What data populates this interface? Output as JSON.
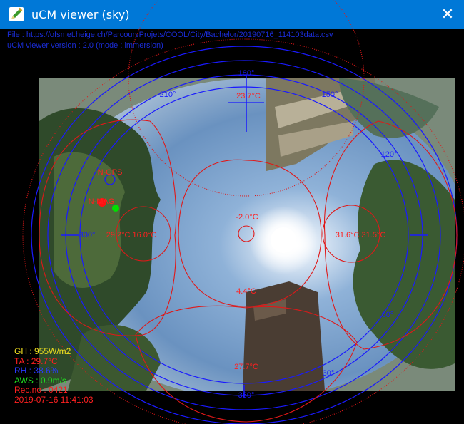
{
  "window": {
    "title": "uCM viewer (sky)",
    "close_glyph": "✕",
    "icon": "pencil-icon"
  },
  "header": {
    "file_line": "File : https://ofsmet.heige.ch/ParcoursProjets/COOL/City/Bachelor/20190716_114103data.csv",
    "version_line": "uCM viewer version : 2.0 (mode : immersion)"
  },
  "sky_labels": {
    "compass": {
      "north": "180°",
      "deg210": "210°",
      "deg150": "150°",
      "deg120": "120°",
      "deg300": "300°",
      "deg60": "60°",
      "deg30": "30°",
      "south": "360°"
    },
    "temperatures": {
      "top": "23.7°C",
      "left": "29.2°C 16.0°C",
      "center": "-2.0°C",
      "right": "31.6°C 31.5°C",
      "below_sun": "4.4°C",
      "bottom": "27.7°C"
    },
    "markers": {
      "n_gps": "N-GPS",
      "n_mag": "N-MAG"
    }
  },
  "readout": {
    "gh": "GH : 955W/m2",
    "ta": "TA : 29.7°C",
    "rh": "RH : 38.6%",
    "aws": "AWS : 0.9m/s",
    "rec": "Rec.no : 0421",
    "datetime": "2019-07-16 11:41:03"
  },
  "colors": {
    "titlebar": "#0078d7",
    "grid_blue": "#1a1aff",
    "overlay_red": "#e01818",
    "gh_text": "#f0e020",
    "green_marker": "#00e000"
  }
}
